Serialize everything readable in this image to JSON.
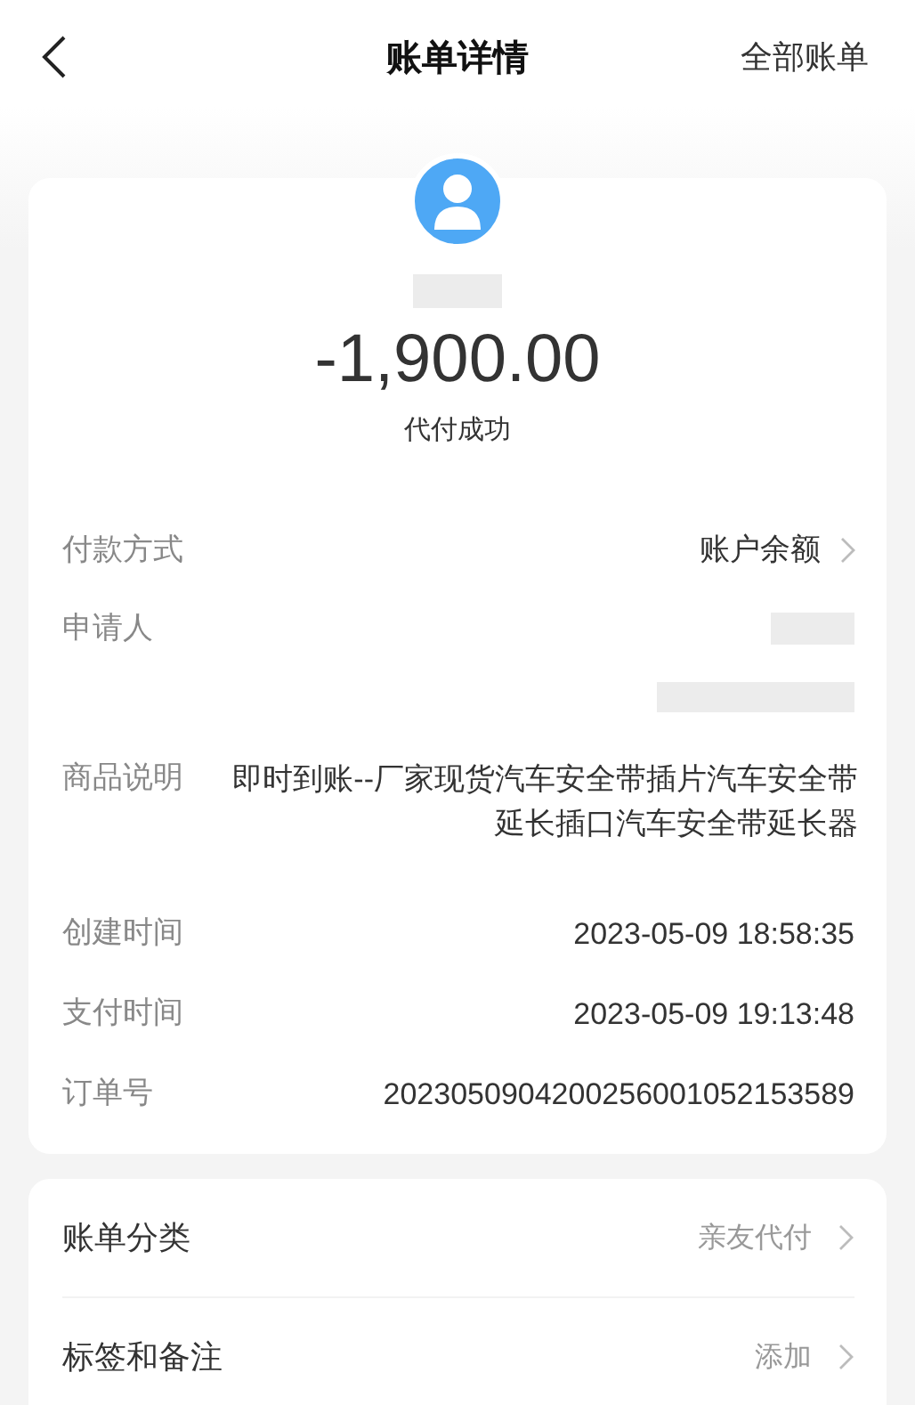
{
  "nav": {
    "title": "账单详情",
    "action": "全部账单"
  },
  "summary": {
    "amount": "-1,900.00",
    "status": "代付成功"
  },
  "details": [
    {
      "kind": "link",
      "label": "付款方式",
      "value": "账户余额"
    },
    {
      "kind": "redacted",
      "label": "申请人"
    },
    {
      "kind": "text",
      "label": "商品说明",
      "value": "即时到账--厂家现货汽车安全带插片汽车安全带延长插口汽车安全带延长器"
    },
    {
      "kind": "text",
      "label": "创建时间",
      "value": "2023-05-09 18:58:35"
    },
    {
      "kind": "text",
      "label": "支付时间",
      "value": "2023-05-09 19:13:48"
    },
    {
      "kind": "text",
      "label": "订单号",
      "value": "2023050904200256001052153589"
    }
  ],
  "actions": [
    {
      "label": "账单分类",
      "value": "亲友代付"
    },
    {
      "label": "标签和备注",
      "value": "添加"
    }
  ]
}
